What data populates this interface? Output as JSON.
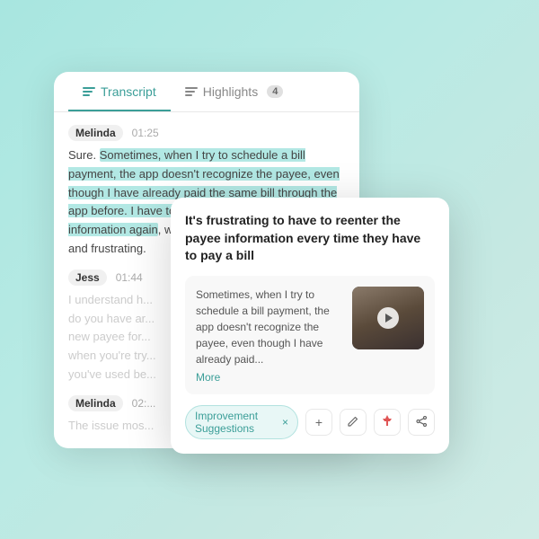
{
  "tabs": [
    {
      "id": "transcript",
      "label": "Transcript",
      "active": true
    },
    {
      "id": "highlights",
      "label": "Highlights",
      "active": false,
      "badge": "4"
    }
  ],
  "transcript": {
    "entries": [
      {
        "speaker": "Melinda",
        "timestamp": "01:25",
        "text_before": "Sure. ",
        "text_highlighted": "Sometimes, when I try to schedule a bill payment, the app doesn't recognize the payee, even though I have already paid the same bill through the app before. I have to manually enter the payee information again",
        "text_after": ", which can be a bit time-consuming and frustrating."
      },
      {
        "speaker": "Jess",
        "timestamp": "01:44",
        "text_partial": "I understand h... do you have ar... new payee for... when you're try... you've used be..."
      },
      {
        "speaker": "Melinda",
        "timestamp": "02:...",
        "text_partial": "The issue mos..."
      }
    ]
  },
  "popup": {
    "title": "It's frustrating to have to reenter the payee information every time they have to pay a bill",
    "quote": "Sometimes, when I try to schedule a bill payment, the app doesn't recognize the payee, even though I have already paid...",
    "more_label": "More",
    "tag": "Improvement Suggestions",
    "actions": [
      {
        "id": "add",
        "icon": "+",
        "label": "add"
      },
      {
        "id": "edit",
        "icon": "✏",
        "label": "edit"
      },
      {
        "id": "pin",
        "icon": "📌",
        "label": "pin"
      },
      {
        "id": "share",
        "icon": "⬆",
        "label": "share"
      }
    ]
  }
}
